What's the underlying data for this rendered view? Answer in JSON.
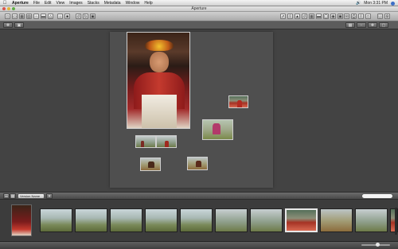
{
  "menubar": {
    "apple_icon": "apple-icon",
    "items": [
      "Aperture",
      "File",
      "Edit",
      "View",
      "Images",
      "Stacks",
      "Metadata",
      "Window",
      "Help"
    ],
    "clock": "Mon 3:31 PM"
  },
  "window": {
    "title": "Aperture"
  },
  "browser_bar": {
    "dropdown_value": "Version Name",
    "search_placeholder": ""
  },
  "status": {
    "text": ""
  },
  "thumbnails": [
    {
      "label": "",
      "style": "ph-field"
    },
    {
      "label": "",
      "style": "ph-field"
    },
    {
      "label": "",
      "style": "ph-field"
    },
    {
      "label": "",
      "style": "ph-field"
    },
    {
      "label": "",
      "style": "ph-field"
    },
    {
      "label": "",
      "style": "ph-people"
    },
    {
      "label": "",
      "style": "ph-people"
    },
    {
      "label": "",
      "style": "ph-red"
    },
    {
      "label": "",
      "style": "ph-dry"
    },
    {
      "label": "",
      "style": "ph-people"
    },
    {
      "label": "",
      "style": "ph-red"
    }
  ],
  "colors": {
    "canvas": "#434343",
    "paper": "#4f4f4f",
    "selection": "#e8e8e8"
  }
}
